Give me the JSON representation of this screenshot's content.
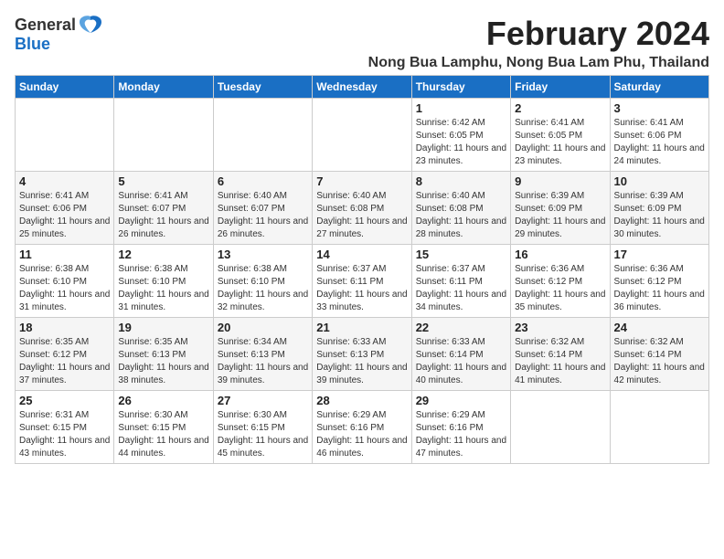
{
  "logo": {
    "general": "General",
    "blue": "Blue"
  },
  "title": "February 2024",
  "subtitle": "Nong Bua Lamphu, Nong Bua Lam Phu, Thailand",
  "weekdays": [
    "Sunday",
    "Monday",
    "Tuesday",
    "Wednesday",
    "Thursday",
    "Friday",
    "Saturday"
  ],
  "rows": [
    [
      {
        "day": "",
        "detail": ""
      },
      {
        "day": "",
        "detail": ""
      },
      {
        "day": "",
        "detail": ""
      },
      {
        "day": "",
        "detail": ""
      },
      {
        "day": "1",
        "detail": "Sunrise: 6:42 AM\nSunset: 6:05 PM\nDaylight: 11 hours and 23 minutes."
      },
      {
        "day": "2",
        "detail": "Sunrise: 6:41 AM\nSunset: 6:05 PM\nDaylight: 11 hours and 23 minutes."
      },
      {
        "day": "3",
        "detail": "Sunrise: 6:41 AM\nSunset: 6:06 PM\nDaylight: 11 hours and 24 minutes."
      }
    ],
    [
      {
        "day": "4",
        "detail": "Sunrise: 6:41 AM\nSunset: 6:06 PM\nDaylight: 11 hours and 25 minutes."
      },
      {
        "day": "5",
        "detail": "Sunrise: 6:41 AM\nSunset: 6:07 PM\nDaylight: 11 hours and 26 minutes."
      },
      {
        "day": "6",
        "detail": "Sunrise: 6:40 AM\nSunset: 6:07 PM\nDaylight: 11 hours and 26 minutes."
      },
      {
        "day": "7",
        "detail": "Sunrise: 6:40 AM\nSunset: 6:08 PM\nDaylight: 11 hours and 27 minutes."
      },
      {
        "day": "8",
        "detail": "Sunrise: 6:40 AM\nSunset: 6:08 PM\nDaylight: 11 hours and 28 minutes."
      },
      {
        "day": "9",
        "detail": "Sunrise: 6:39 AM\nSunset: 6:09 PM\nDaylight: 11 hours and 29 minutes."
      },
      {
        "day": "10",
        "detail": "Sunrise: 6:39 AM\nSunset: 6:09 PM\nDaylight: 11 hours and 30 minutes."
      }
    ],
    [
      {
        "day": "11",
        "detail": "Sunrise: 6:38 AM\nSunset: 6:10 PM\nDaylight: 11 hours and 31 minutes."
      },
      {
        "day": "12",
        "detail": "Sunrise: 6:38 AM\nSunset: 6:10 PM\nDaylight: 11 hours and 31 minutes."
      },
      {
        "day": "13",
        "detail": "Sunrise: 6:38 AM\nSunset: 6:10 PM\nDaylight: 11 hours and 32 minutes."
      },
      {
        "day": "14",
        "detail": "Sunrise: 6:37 AM\nSunset: 6:11 PM\nDaylight: 11 hours and 33 minutes."
      },
      {
        "day": "15",
        "detail": "Sunrise: 6:37 AM\nSunset: 6:11 PM\nDaylight: 11 hours and 34 minutes."
      },
      {
        "day": "16",
        "detail": "Sunrise: 6:36 AM\nSunset: 6:12 PM\nDaylight: 11 hours and 35 minutes."
      },
      {
        "day": "17",
        "detail": "Sunrise: 6:36 AM\nSunset: 6:12 PM\nDaylight: 11 hours and 36 minutes."
      }
    ],
    [
      {
        "day": "18",
        "detail": "Sunrise: 6:35 AM\nSunset: 6:12 PM\nDaylight: 11 hours and 37 minutes."
      },
      {
        "day": "19",
        "detail": "Sunrise: 6:35 AM\nSunset: 6:13 PM\nDaylight: 11 hours and 38 minutes."
      },
      {
        "day": "20",
        "detail": "Sunrise: 6:34 AM\nSunset: 6:13 PM\nDaylight: 11 hours and 39 minutes."
      },
      {
        "day": "21",
        "detail": "Sunrise: 6:33 AM\nSunset: 6:13 PM\nDaylight: 11 hours and 39 minutes."
      },
      {
        "day": "22",
        "detail": "Sunrise: 6:33 AM\nSunset: 6:14 PM\nDaylight: 11 hours and 40 minutes."
      },
      {
        "day": "23",
        "detail": "Sunrise: 6:32 AM\nSunset: 6:14 PM\nDaylight: 11 hours and 41 minutes."
      },
      {
        "day": "24",
        "detail": "Sunrise: 6:32 AM\nSunset: 6:14 PM\nDaylight: 11 hours and 42 minutes."
      }
    ],
    [
      {
        "day": "25",
        "detail": "Sunrise: 6:31 AM\nSunset: 6:15 PM\nDaylight: 11 hours and 43 minutes."
      },
      {
        "day": "26",
        "detail": "Sunrise: 6:30 AM\nSunset: 6:15 PM\nDaylight: 11 hours and 44 minutes."
      },
      {
        "day": "27",
        "detail": "Sunrise: 6:30 AM\nSunset: 6:15 PM\nDaylight: 11 hours and 45 minutes."
      },
      {
        "day": "28",
        "detail": "Sunrise: 6:29 AM\nSunset: 6:16 PM\nDaylight: 11 hours and 46 minutes."
      },
      {
        "day": "29",
        "detail": "Sunrise: 6:29 AM\nSunset: 6:16 PM\nDaylight: 11 hours and 47 minutes."
      },
      {
        "day": "",
        "detail": ""
      },
      {
        "day": "",
        "detail": ""
      }
    ]
  ]
}
